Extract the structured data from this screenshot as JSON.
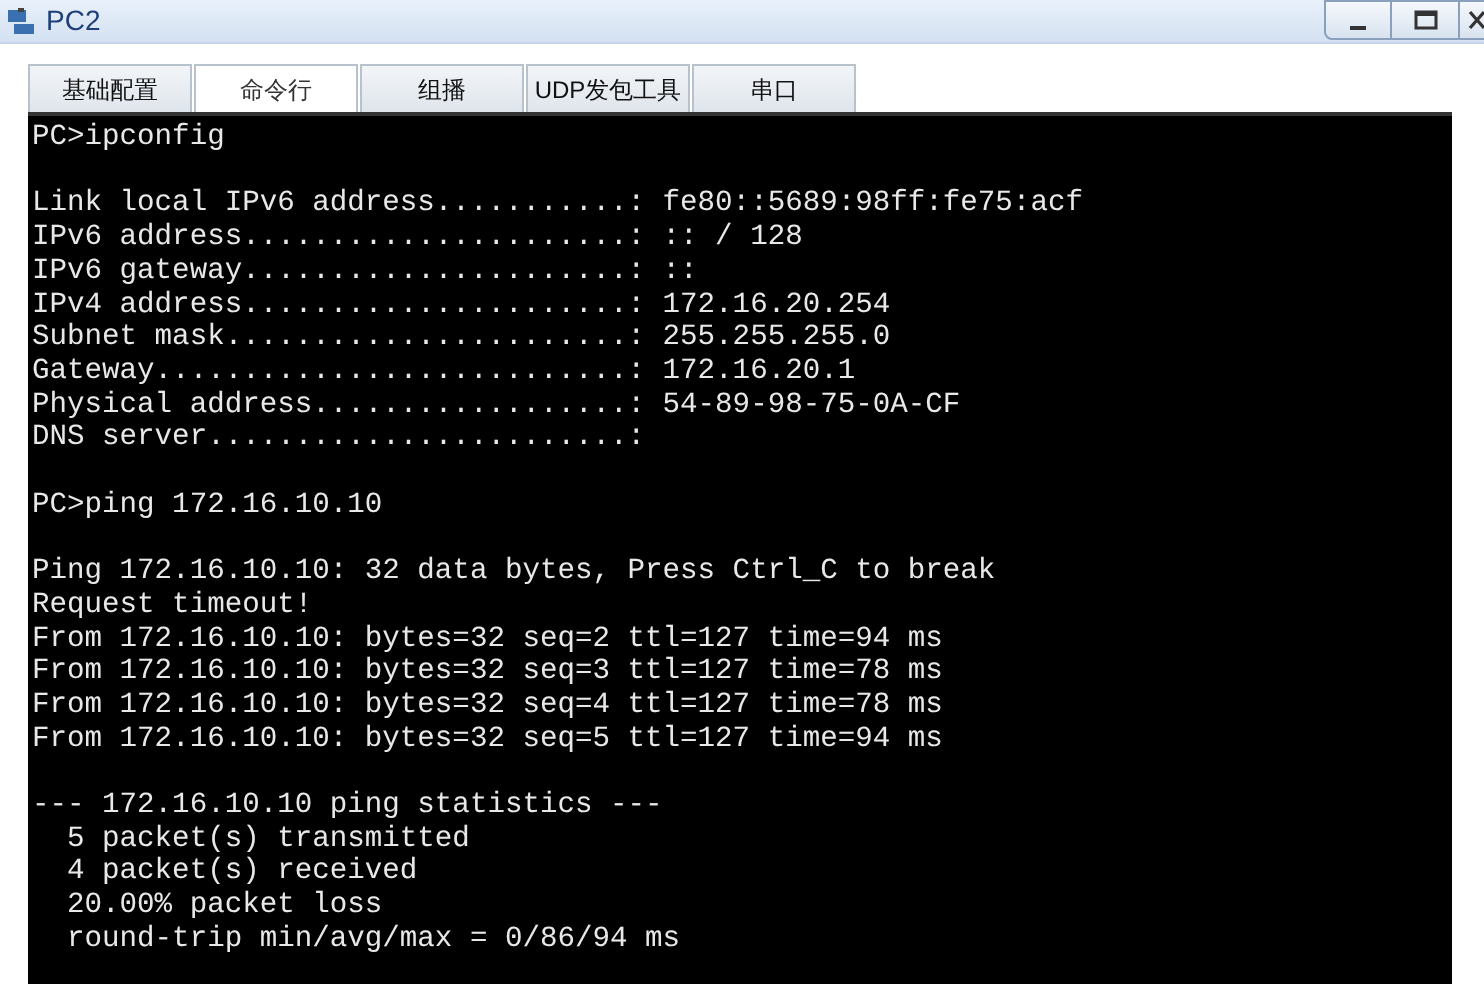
{
  "window": {
    "title": "PC2"
  },
  "tabs": [
    {
      "label": "基础配置",
      "selected": false
    },
    {
      "label": "命令行",
      "selected": true
    },
    {
      "label": "组播",
      "selected": false
    },
    {
      "label": "UDP发包工具",
      "selected": false
    },
    {
      "label": "串口",
      "selected": false
    }
  ],
  "terminal": {
    "blocks": [
      [
        "PC>ipconfig"
      ],
      [
        "Link local IPv6 address...........: fe80::5689:98ff:fe75:acf",
        "IPv6 address......................: :: / 128",
        "IPv6 gateway......................: ::",
        "IPv4 address......................: 172.16.20.254",
        "Subnet mask.......................: 255.255.255.0",
        "Gateway...........................: 172.16.20.1",
        "Physical address..................: 54-89-98-75-0A-CF",
        "DNS server........................:"
      ],
      [
        "PC>ping 172.16.10.10"
      ],
      [
        "Ping 172.16.10.10: 32 data bytes, Press Ctrl_C to break",
        "Request timeout!",
        "From 172.16.10.10: bytes=32 seq=2 ttl=127 time=94 ms",
        "From 172.16.10.10: bytes=32 seq=3 ttl=127 time=78 ms",
        "From 172.16.10.10: bytes=32 seq=4 ttl=127 time=78 ms",
        "From 172.16.10.10: bytes=32 seq=5 ttl=127 time=94 ms"
      ],
      [
        "--- 172.16.10.10 ping statistics ---",
        "  5 packet(s) transmitted",
        "  4 packet(s) received",
        "  20.00% packet loss",
        "  round-trip min/avg/max = 0/86/94 ms"
      ]
    ]
  }
}
